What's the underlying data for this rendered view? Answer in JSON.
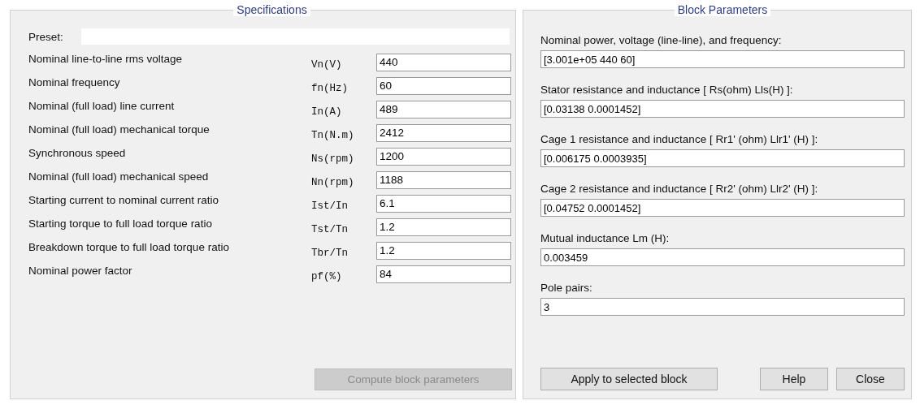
{
  "specifications": {
    "title": "Specifications",
    "preset": {
      "label": "Preset:"
    },
    "rows": [
      {
        "label": "Nominal line-to-line rms voltage",
        "symbol": "Vn(V)",
        "value": "440"
      },
      {
        "label": "Nominal frequency",
        "symbol": "fn(Hz)",
        "value": "60"
      },
      {
        "label": "Nominal (full load) line current",
        "symbol": "In(A)",
        "value": "489"
      },
      {
        "label": "Nominal (full load) mechanical torque",
        "symbol": "Tn(N.m)",
        "value": "2412"
      },
      {
        "label": "Synchronous speed",
        "symbol": "Ns(rpm)",
        "value": "1200"
      },
      {
        "label": "Nominal (full load) mechanical speed",
        "symbol": "Nn(rpm)",
        "value": "1188"
      },
      {
        "label": "Starting current to nominal current ratio",
        "symbol": "Ist/In",
        "value": "6.1"
      },
      {
        "label": "Starting torque to full load torque ratio",
        "symbol": "Tst/Tn",
        "value": "1.2"
      },
      {
        "label": "Breakdown torque to full load torque ratio",
        "symbol": "Tbr/Tn",
        "value": "1.2"
      },
      {
        "label": "Nominal power factor",
        "symbol": "pf(%)",
        "value": "84"
      }
    ],
    "compute_button": {
      "label": "Compute block parameters",
      "disabled": true
    }
  },
  "block_parameters": {
    "title": "Block Parameters",
    "params": [
      {
        "label": "Nominal power, voltage (line-line), and frequency:",
        "value": "[3.001e+05 440 60]"
      },
      {
        "label": "Stator resistance and inductance [ Rs(ohm)  Lls(H) ]:",
        "value": "[0.03138 0.0001452]"
      },
      {
        "label": "Cage 1 resistance and inductance  [ Rr1' (ohm)  Llr1' (H) ]:",
        "value": "[0.006175 0.0003935]"
      },
      {
        "label": "Cage 2 resistance and inductance  [ Rr2' (ohm)  Llr2' (H) ]:",
        "value": "[0.04752 0.0001452]"
      },
      {
        "label": "Mutual inductance Lm (H):",
        "value": "0.003459"
      },
      {
        "label": "Pole pairs:",
        "value": "3"
      }
    ],
    "buttons": [
      {
        "label": "Apply to selected block",
        "kind": "apply"
      },
      {
        "label": "Help",
        "kind": "help"
      },
      {
        "label": "Close",
        "kind": "close"
      }
    ]
  }
}
